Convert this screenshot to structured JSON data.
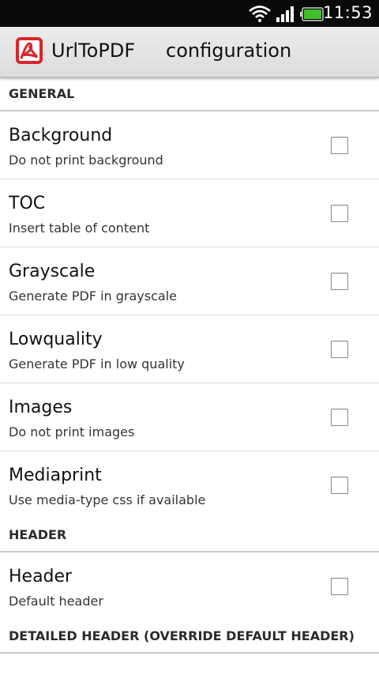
{
  "status_bar": {
    "time": "11:53",
    "icons": [
      "wifi-icon",
      "signal-icon",
      "battery-icon"
    ],
    "battery_color": "#3fbf2a"
  },
  "action_bar": {
    "app_name": "UrlToPDF",
    "activity_title": "configuration",
    "app_icon": "pdf-logo-icon",
    "icon_color": "#d8262b"
  },
  "sections": [
    {
      "title": "GENERAL",
      "items": [
        {
          "title": "Background",
          "summary": "Do not print background",
          "checked": false
        },
        {
          "title": "TOC",
          "summary": "Insert table of content",
          "checked": false
        },
        {
          "title": "Grayscale",
          "summary": "Generate PDF in grayscale",
          "checked": false
        },
        {
          "title": "Lowquality",
          "summary": "Generate PDF in low quality",
          "checked": false
        },
        {
          "title": "Images",
          "summary": "Do not print images",
          "checked": false
        },
        {
          "title": "Mediaprint",
          "summary": "Use media-type css if available",
          "checked": false
        }
      ]
    },
    {
      "title": "HEADER",
      "items": [
        {
          "title": "Header",
          "summary": "Default header",
          "checked": false
        }
      ]
    },
    {
      "title": "DETAILED HEADER (OVERRIDE DEFAULT HEADER)",
      "items": []
    }
  ]
}
